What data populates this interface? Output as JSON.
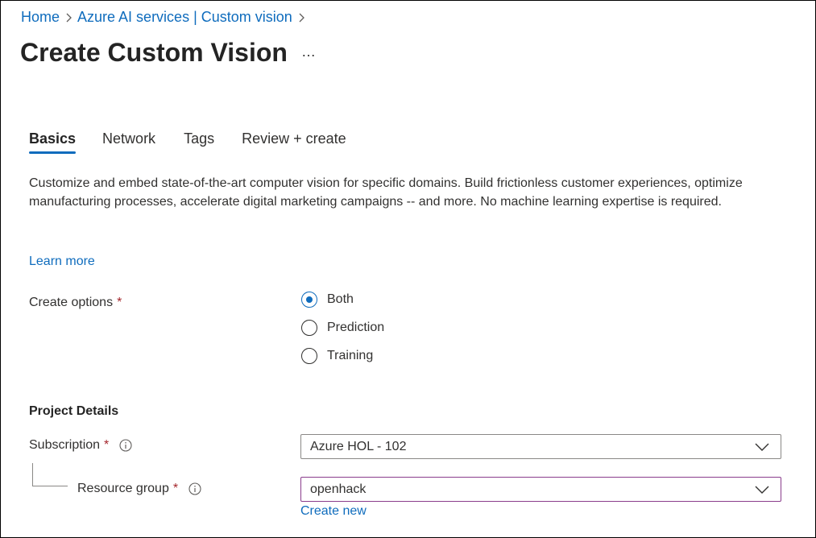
{
  "breadcrumb": {
    "items": [
      "Home",
      "Azure AI services | Custom vision"
    ]
  },
  "page": {
    "title": "Create Custom Vision",
    "more_label": "…"
  },
  "tabs": [
    {
      "label": "Basics",
      "active": true
    },
    {
      "label": "Network",
      "active": false
    },
    {
      "label": "Tags",
      "active": false
    },
    {
      "label": "Review + create",
      "active": false
    }
  ],
  "description": "Customize and embed state-of-the-art computer vision for specific domains. Build frictionless customer experiences, optimize manufacturing processes, accelerate digital marketing campaigns -- and more. No machine learning expertise is required.",
  "learn_more": "Learn more",
  "create_options": {
    "label": "Create options",
    "required_mark": "*",
    "options": [
      {
        "label": "Both",
        "checked": true
      },
      {
        "label": "Prediction",
        "checked": false
      },
      {
        "label": "Training",
        "checked": false
      }
    ]
  },
  "project_details": {
    "heading": "Project Details",
    "subscription": {
      "label": "Subscription",
      "required_mark": "*",
      "value": "Azure HOL - 102"
    },
    "resource_group": {
      "label": "Resource group",
      "required_mark": "*",
      "value": "openhack",
      "create_new": "Create new"
    }
  },
  "colors": {
    "accent": "#0f6cbd",
    "required": "#a4262c",
    "focus_border": "#8a3c8c"
  }
}
